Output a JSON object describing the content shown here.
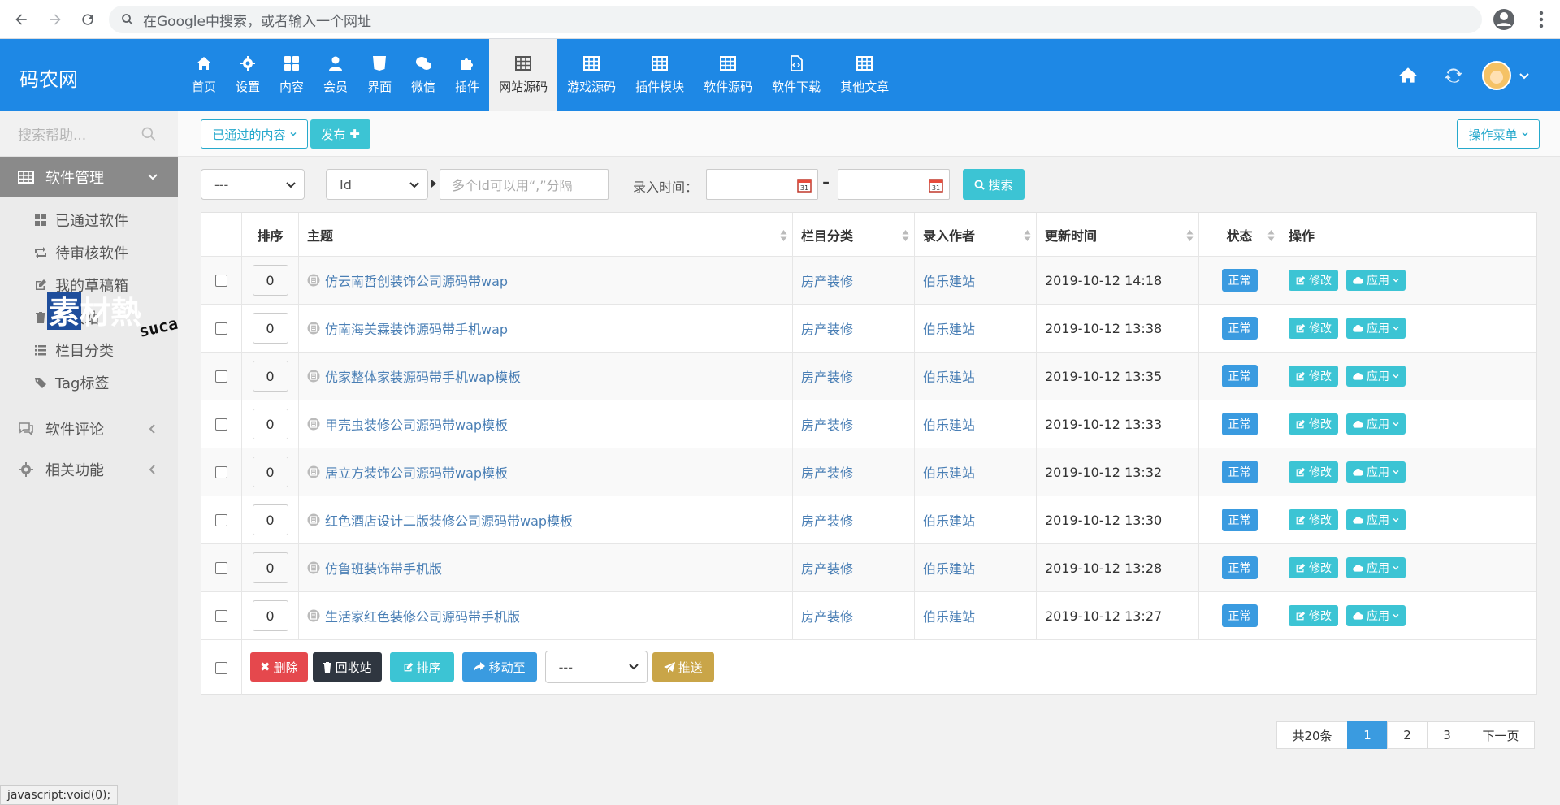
{
  "browser": {
    "omnibox_placeholder": "在Google中搜索，或者输入一个网址"
  },
  "header": {
    "brand": "码农网",
    "nav": [
      {
        "label": "首页",
        "icon": "home-icon"
      },
      {
        "label": "设置",
        "icon": "gear-icon"
      },
      {
        "label": "内容",
        "icon": "grid-icon"
      },
      {
        "label": "会员",
        "icon": "user-icon"
      },
      {
        "label": "界面",
        "icon": "html5-icon"
      },
      {
        "label": "微信",
        "icon": "wechat-icon"
      },
      {
        "label": "插件",
        "icon": "puzzle-icon"
      },
      {
        "label": "网站源码",
        "icon": "table-icon"
      },
      {
        "label": "游戏源码",
        "icon": "table-icon"
      },
      {
        "label": "插件模块",
        "icon": "table-icon"
      },
      {
        "label": "软件源码",
        "icon": "table-icon"
      },
      {
        "label": "软件下载",
        "icon": "file-code-icon"
      },
      {
        "label": "其他文章",
        "icon": "table-icon"
      }
    ],
    "active_nav": "网站源码"
  },
  "sidebar": {
    "search_placeholder": "搜索帮助...",
    "groups": [
      {
        "label": "软件管理",
        "icon": "table-icon"
      },
      {
        "label": "软件评论",
        "icon": "comments-icon"
      },
      {
        "label": "相关功能",
        "icon": "gear-icon"
      }
    ],
    "subitems": [
      {
        "label": "已通过软件",
        "icon": "grid-icon"
      },
      {
        "label": "待审核软件",
        "icon": "retweet-icon"
      },
      {
        "label": "我的草稿箱",
        "icon": "edit-icon"
      },
      {
        "label": "回收站",
        "icon": "trash-icon"
      },
      {
        "label": "栏目分类",
        "icon": "list-icon"
      },
      {
        "label": "Tag标签",
        "icon": "tags-icon"
      }
    ]
  },
  "watermark": {
    "main": "素材熱",
    "sub": "sucaire.com"
  },
  "toolbar": {
    "content_filter": "已通过的内容",
    "publish": "发布",
    "ops_menu": "操作菜单"
  },
  "filters": {
    "select1": "---",
    "field_select": "Id",
    "id_placeholder": "多个Id可以用“,”分隔",
    "time_label": "录入时间：",
    "dash": "-",
    "search": "搜索"
  },
  "table": {
    "headers": {
      "order": "排序",
      "title": "主题",
      "category": "栏目分类",
      "author": "录入作者",
      "updated": "更新时间",
      "status": "状态",
      "ops": "操作"
    },
    "rows": [
      {
        "order": "0",
        "title": "仿云南哲创装饰公司源码带wap",
        "category": "房产装修",
        "author": "伯乐建站",
        "updated": "2019-10-12 14:18",
        "status": "正常"
      },
      {
        "order": "0",
        "title": "仿南海美霖装饰源码带手机wap",
        "category": "房产装修",
        "author": "伯乐建站",
        "updated": "2019-10-12 13:38",
        "status": "正常"
      },
      {
        "order": "0",
        "title": "优家整体家装源码带手机wap模板",
        "category": "房产装修",
        "author": "伯乐建站",
        "updated": "2019-10-12 13:35",
        "status": "正常"
      },
      {
        "order": "0",
        "title": "甲壳虫装修公司源码带wap模板",
        "category": "房产装修",
        "author": "伯乐建站",
        "updated": "2019-10-12 13:33",
        "status": "正常"
      },
      {
        "order": "0",
        "title": "居立方装饰公司源码带wap模板",
        "category": "房产装修",
        "author": "伯乐建站",
        "updated": "2019-10-12 13:32",
        "status": "正常"
      },
      {
        "order": "0",
        "title": "红色酒店设计二版装修公司源码带wap模板",
        "category": "房产装修",
        "author": "伯乐建站",
        "updated": "2019-10-12 13:30",
        "status": "正常"
      },
      {
        "order": "0",
        "title": "仿鲁班装饰带手机版",
        "category": "房产装修",
        "author": "伯乐建站",
        "updated": "2019-10-12 13:28",
        "status": "正常"
      },
      {
        "order": "0",
        "title": "生活家红色装修公司源码带手机版",
        "category": "房产装修",
        "author": "伯乐建站",
        "updated": "2019-10-12 13:27",
        "status": "正常"
      }
    ],
    "row_ops": {
      "edit": "修改",
      "apply": "应用"
    },
    "footer": {
      "delete": "删除",
      "recycle": "回收站",
      "sort": "排序",
      "move": "移动至",
      "select": "---",
      "push": "推送"
    }
  },
  "pagination": {
    "total": "共20条",
    "pages": [
      "1",
      "2",
      "3"
    ],
    "active": "1",
    "next": "下一页"
  },
  "statusbar": "javascript:void(0);"
}
